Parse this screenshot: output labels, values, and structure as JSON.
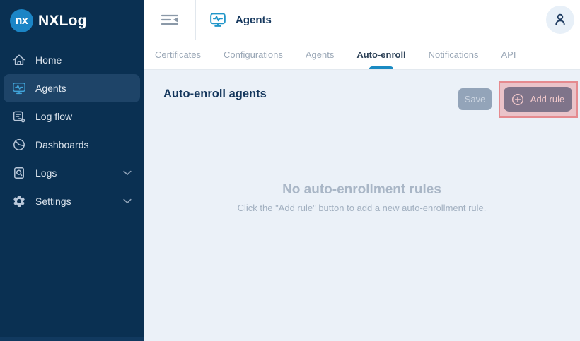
{
  "app": {
    "brand": "NXLog",
    "logo_monogram": "nx"
  },
  "sidebar": {
    "items": [
      {
        "label": "Home",
        "icon": "home-icon",
        "active": false,
        "expandable": false
      },
      {
        "label": "Agents",
        "icon": "agents-icon",
        "active": true,
        "expandable": false
      },
      {
        "label": "Log flow",
        "icon": "log-flow-icon",
        "active": false,
        "expandable": false
      },
      {
        "label": "Dashboards",
        "icon": "dashboards-icon",
        "active": false,
        "expandable": false
      },
      {
        "label": "Logs",
        "icon": "logs-icon",
        "active": false,
        "expandable": true
      },
      {
        "label": "Settings",
        "icon": "settings-icon",
        "active": false,
        "expandable": true
      }
    ]
  },
  "header": {
    "title": "Agents",
    "icons": [
      "sidebar-collapse-icon",
      "agents-page-icon",
      "user-avatar-icon"
    ]
  },
  "tabs": {
    "items": [
      {
        "label": "Certificates"
      },
      {
        "label": "Configurations"
      },
      {
        "label": "Agents"
      },
      {
        "label": "Auto-enroll"
      },
      {
        "label": "Notifications"
      },
      {
        "label": "API"
      }
    ],
    "active": "Auto-enroll"
  },
  "content": {
    "heading": "Auto-enroll agents",
    "save_label": "Save",
    "add_rule_label": "Add rule",
    "empty_title": "No auto-enrollment rules",
    "empty_subtitle": "Click the \"Add rule\" button to add a new auto-enrollment rule."
  },
  "colors": {
    "sidebar_navy": "#0a3052",
    "sidebar_active_item": "#1e4468",
    "accent_blue": "#1a8ac2",
    "icon_blue": "#41a5da",
    "heading_navy": "#14375d",
    "content_background": "#ebf1f8",
    "save_button_disabled": "#93a4b9",
    "add_rule_button": "#15537a",
    "annotation_highlight": "#ea969a",
    "tab_inactive_text": "#9aa7b6"
  }
}
